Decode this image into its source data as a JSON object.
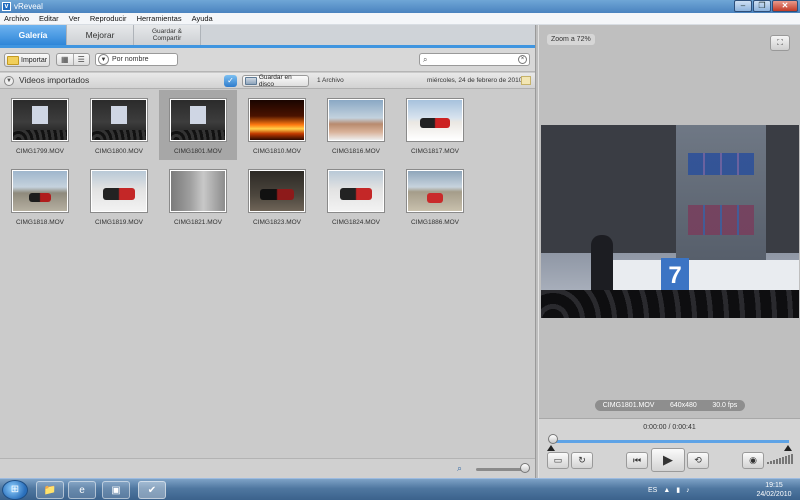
{
  "window": {
    "title": "vReveal",
    "minimize_glyph": "–",
    "restore_glyph": "❐",
    "close_glyph": "✕"
  },
  "menu": [
    "Archivo",
    "Editar",
    "Ver",
    "Reproducir",
    "Herramientas",
    "Ayuda"
  ],
  "tabs": [
    {
      "label": "Galería",
      "active": true
    },
    {
      "label": "Mejorar",
      "active": false
    },
    {
      "label": "Guardar &",
      "label2": "Compartir",
      "active": false
    }
  ],
  "toolbar": {
    "import_label": "Importar",
    "sort_label": "Por nombre",
    "search_value": ""
  },
  "group": {
    "title": "Videos importados",
    "save_disk_label": "Guardar en disco",
    "file_count": "1 Archivo",
    "date": "miércoles, 24 de febrero de 2010"
  },
  "thumbnails": [
    {
      "name": "CIMG1799.MOV",
      "art": "room",
      "selected": false
    },
    {
      "name": "CIMG1800.MOV",
      "art": "room",
      "selected": false
    },
    {
      "name": "CIMG1801.MOV",
      "art": "room",
      "selected": true
    },
    {
      "name": "CIMG1810.MOV",
      "art": "fire",
      "selected": false
    },
    {
      "name": "CIMG1816.MOV",
      "art": "hand",
      "selected": false
    },
    {
      "name": "CIMG1817.MOV",
      "art": "phone-red",
      "selected": false
    },
    {
      "name": "CIMG1818.MOV",
      "art": "road",
      "selected": false
    },
    {
      "name": "CIMG1819.MOV",
      "art": "table",
      "selected": false
    },
    {
      "name": "CIMG1821.MOV",
      "art": "grey",
      "selected": false
    },
    {
      "name": "CIMG1823.MOV",
      "art": "dark-phones",
      "selected": false
    },
    {
      "name": "CIMG1824.MOV",
      "art": "table",
      "selected": false
    },
    {
      "name": "CIMG1886.MOV",
      "art": "landscape",
      "selected": false
    }
  ],
  "preview": {
    "zoom_label": "Zoom a 72%",
    "clip_name": "CIMG1801.MOV",
    "resolution": "640x480",
    "fps": "30.0 fps",
    "banner_text": "7",
    "timecode": "0:00:00 / 0:00:41"
  },
  "taskbar": {
    "start_glyph": "⊞",
    "language": "ES",
    "time": "19:15",
    "date": "24/02/2010"
  },
  "icons": {
    "import": "folder-icon",
    "search": "search-icon",
    "clear": "clear-icon",
    "play": "play-icon",
    "camera": "camera-icon"
  },
  "colors": {
    "accent": "#2f86d8",
    "selected_thumb": "#a7a7a7",
    "seek_bar": "#5ea3e6"
  }
}
